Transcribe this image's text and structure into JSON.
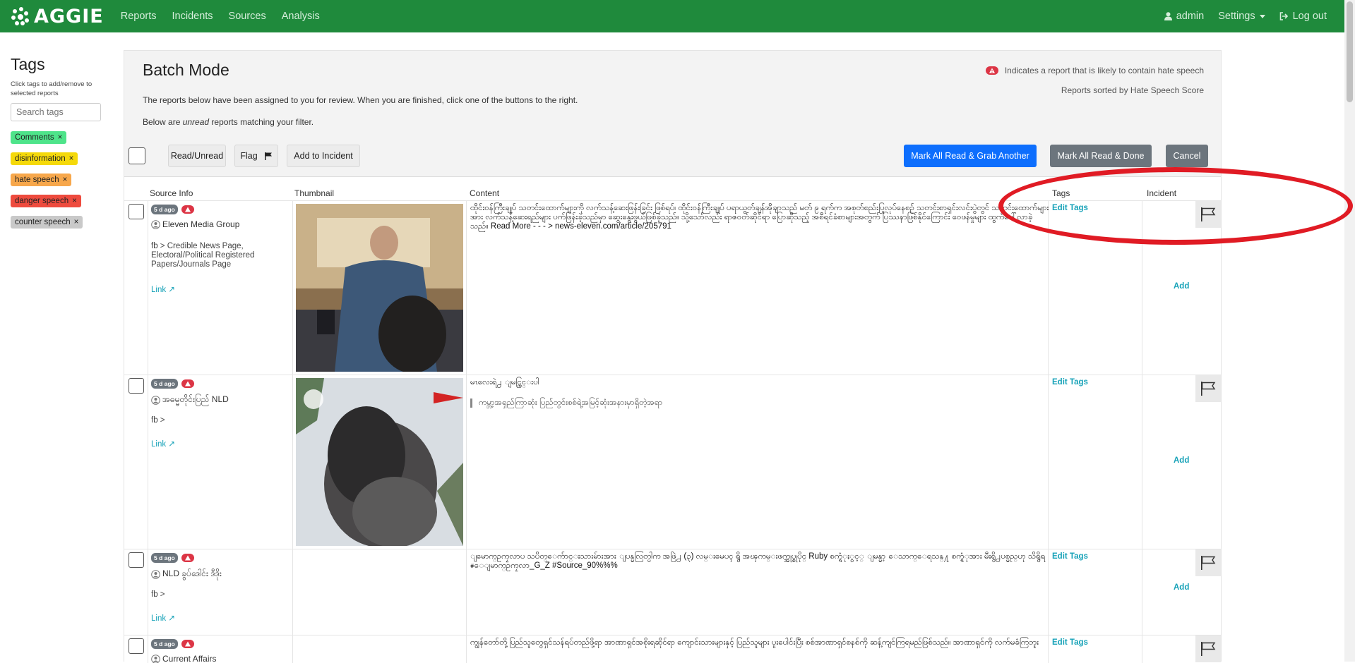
{
  "nav": {
    "brand": "AGGIE",
    "links": [
      "Reports",
      "Incidents",
      "Sources",
      "Analysis"
    ],
    "user": "admin",
    "settings": "Settings",
    "logout": "Log out"
  },
  "sidebar": {
    "title": "Tags",
    "hint": "Click tags to add/remove to selected reports",
    "search_placeholder": "Search tags",
    "tags": [
      {
        "label": "Comments",
        "color": "#4ee48a"
      },
      {
        "label": "disinformation",
        "color": "#f5d90a"
      },
      {
        "label": "hate speech",
        "color": "#f7a74b"
      },
      {
        "label": "danger speech",
        "color": "#ee4b3e"
      },
      {
        "label": "counter speech",
        "color": "#c9c9c9"
      }
    ],
    "remove_glyph": "×"
  },
  "batch": {
    "title": "Batch Mode",
    "desc1": "The reports below have been assigned to you for review. When you are finished, click one of the buttons to the right.",
    "desc2_prefix": "Below are ",
    "desc2_em": "unread",
    "desc2_suffix": " reports matching your filter.",
    "legend": "Indicates a report that is likely to contain hate speech",
    "sorted": "Reports sorted by Hate Speech Score",
    "buttons": {
      "read_unread": "Read/Unread",
      "flag": "Flag",
      "add_to_incident": "Add to Incident",
      "grab_another": "Mark All Read & Grab Another",
      "done": "Mark All Read & Done",
      "cancel": "Cancel"
    },
    "colors": {
      "primary": "#0d6efd",
      "secondary": "#6c757d",
      "highlight": "#e01b24"
    }
  },
  "table": {
    "headers": {
      "source": "Source Info",
      "thumbnail": "Thumbnail",
      "content": "Content",
      "tags": "Tags",
      "incident": "Incident"
    },
    "edit_tags": "Edit Tags",
    "add": "Add",
    "link": "Link",
    "rows": [
      {
        "age": "5 d ago",
        "author": "Eleven Media Group",
        "source": "fb > Credible News Page, Electoral/Political Registered Papers/Journals Page",
        "content": "ထိုင်းဝန်ကြီးချုပ် သတင်းထောက်များကို လက်သန့်ဆေးဖြန်းခြင်း ဖြစ်ရပ်၊ ထိုင်းဝန်ကြီးချုပ် ပရာယွတ်ချန်အိုချာသည် မတ် ၉ ရက်က အစုတ်စည်းပြုလုပ်နေစဉ် သတင်းစာရှင်းလင်းပွဲတွင် သတင်းထောက်များအား လက်သန့်ဆေးရည်များ ပက်ဖြန်းခဲ့သည်မှာ ဆွေးနွေးဖွယ်ဖြစ်ခဲ့သည်။ သို့သော်လည်း ရာဇဝတ်ဆိုင်ရာ ပြောဆိုသည့် အစီရင်ခံစာများအတွက် ပြဿနာဖြစ်နိုင်ကြောင်း ဝေဖန်မှုများ ထွက်ပေါ်လာခဲ့သည်။ Read More - - - > news-eleven.com/article/205791"
      },
      {
        "age": "5 d ago",
        "author": "အဓမ္မတိုင်းပြည် NLD",
        "source": "fb >",
        "content": "မၤလေးရဲ႕ ျမင္ကြင္းပါ",
        "quote": "ကမ္ဘာ့အရှည်ကြာဆုံး ပြည်တွင်းစစ်ရဲ့အမြင့်ဆုံးအနားမှာရှိတဲ့အရာ"
      },
      {
        "age": "5 d ago",
        "author": "NLD ခွပ်ဒေါင်း ဒီဒိုး",
        "source": "fb >",
        "content": "ျမောက္ဥကၠလာပ သပိတ္ေက်ာင္းသားမ်ားအား ျပန္မလြတ္ပါက အဖြဲ႕ (၃) လမ္းမေပၚ ရွိ အၾကမ္းဖက္အုပ္စုပိုင္ Ruby စက္ရံုႏွင့္ ျမန္မာ့ ေသာက္ေရသန္႔ စက္ရံုအား မီးရွိ႕ပစ္မည္ဟု သိရွိရ #ေျမာက္ဥကၠလာ_G_Z #Source_90%%%"
      },
      {
        "age": "5 d ago",
        "author": "Current Affairs",
        "source": "fb >",
        "content": "ကျွန်တော်တို့ပြည်သူတွေရှင်သန်ရပ်တည်ဖို့ရာ အာဏာရှင်အစိုးရဆိုင်ရာ ကျောင်းသားများနှင့် ပြည်သူများ ပူးပေါင်းပြီး စစ်အာဏာရှင်စနစ်ကို ဆန့်ကျင်ကြရမည်ဖြစ်သည်။ အာဏာရှင်ကို လက်မခံကြဘူး"
      }
    ]
  }
}
